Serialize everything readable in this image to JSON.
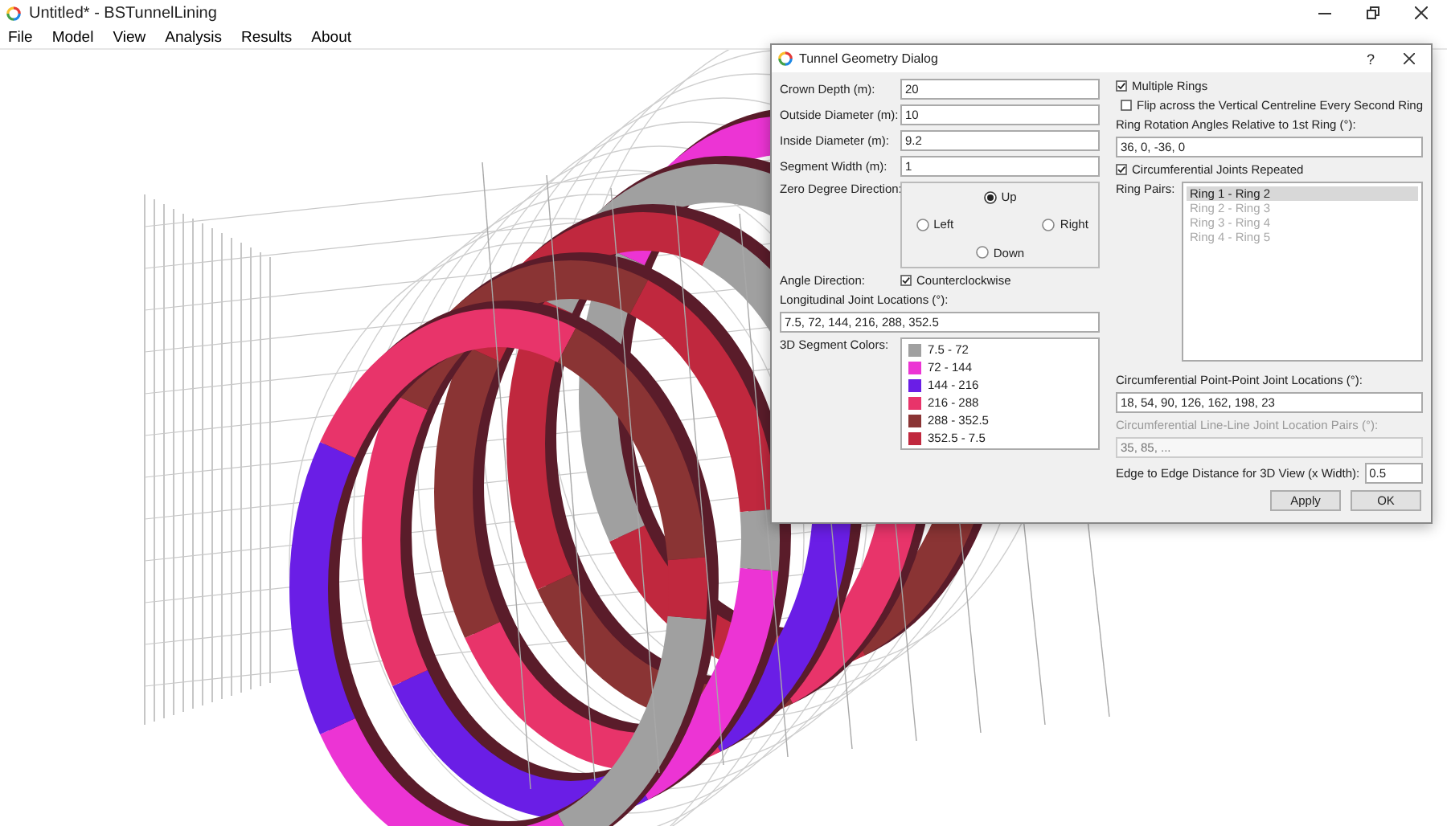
{
  "window": {
    "title": "Untitled* - BSTunnelLining"
  },
  "menu": [
    "File",
    "Model",
    "View",
    "Analysis",
    "Results",
    "About"
  ],
  "dialog": {
    "title": "Tunnel Geometry Dialog",
    "help": "?",
    "fields": [
      {
        "label": "Crown Depth (m):",
        "value": "20"
      },
      {
        "label": "Outside Diameter (m):",
        "value": "10"
      },
      {
        "label": "Inside Diameter (m):",
        "value": "9.2"
      },
      {
        "label": "Segment Width (m):",
        "value": "1"
      }
    ],
    "zero_direction": {
      "label": "Zero Degree Direction:",
      "options": [
        {
          "label": "Up",
          "selected": true
        },
        {
          "label": "Left",
          "selected": false
        },
        {
          "label": "Right",
          "selected": false
        },
        {
          "label": "Down",
          "selected": false
        }
      ]
    },
    "angle_direction": {
      "label": "Angle Direction:",
      "checkbox": {
        "label": "Counterclockwise",
        "checked": true
      }
    },
    "longitudinal_joints": {
      "label": "Longitudinal Joint Locations (°):",
      "value": "7.5, 72, 144, 216, 288, 352.5"
    },
    "segment_colors": {
      "label": "3D Segment Colors:",
      "items": [
        {
          "label": "7.5 - 72",
          "color": "#a0a0a0"
        },
        {
          "label": "72 - 144",
          "color": "#ec34d4"
        },
        {
          "label": "144 - 216",
          "color": "#6a1ee6"
        },
        {
          "label": "216 - 288",
          "color": "#e8346a"
        },
        {
          "label": "288 - 352.5",
          "color": "#8a3434"
        },
        {
          "label": "352.5 - 7.5",
          "color": "#c0283e"
        }
      ]
    },
    "multiple_rings": {
      "label": "Multiple Rings",
      "checked": true
    },
    "flip": {
      "label": "Flip across the Vertical Centreline Every Second Ring",
      "checked": false
    },
    "ring_rotation": {
      "label": "Ring Rotation Angles Relative to 1st Ring (°):",
      "value": "36, 0, -36, 0"
    },
    "circ_repeated": {
      "label": "Circumferential Joints Repeated",
      "checked": true
    },
    "ring_pairs": {
      "label": "Ring Pairs:",
      "items": [
        {
          "label": "Ring 1 - Ring 2",
          "selected": true,
          "disabled": false
        },
        {
          "label": "Ring 2 - Ring 3",
          "selected": false,
          "disabled": true
        },
        {
          "label": "Ring 3 - Ring 4",
          "selected": false,
          "disabled": true
        },
        {
          "label": "Ring 4 - Ring 5",
          "selected": false,
          "disabled": true
        }
      ]
    },
    "point_joints": {
      "label": "Circumferential Point-Point Joint Locations (°):",
      "value": "18, 54, 90, 126, 162, 198, 23"
    },
    "line_joints": {
      "label": "Circumferential Line-Line Joint Location Pairs (°):",
      "placeholder": "35, 85, ...",
      "disabled": true
    },
    "edge_distance": {
      "label": "Edge to Edge Distance for 3D View (x Width):",
      "value": "0.5"
    },
    "buttons": [
      "Apply",
      "OK"
    ]
  }
}
